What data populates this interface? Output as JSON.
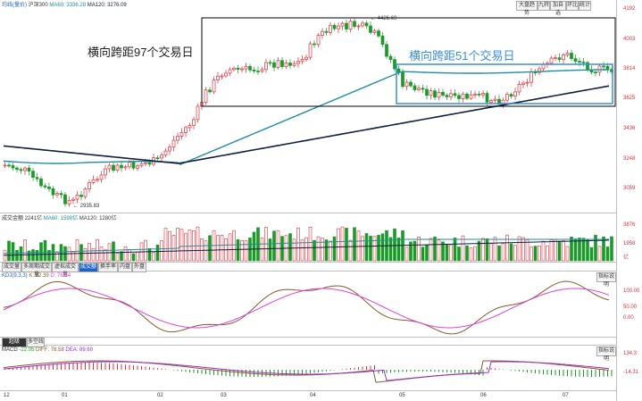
{
  "top_toolbar": {
    "buttons": [
      "大盘趋势",
      "九转",
      "加自选",
      "环比",
      "统计"
    ]
  },
  "main_chart": {
    "legend": {
      "indicator": "均线(量价)",
      "stock": "沪深300",
      "ma60": "MA60: 3336.28",
      "ma120": "MA120: 3276.09"
    },
    "axis": [
      "4192",
      "4003",
      "3814",
      "3625",
      "3436",
      "3248",
      "3059"
    ],
    "high_label": "4426.69",
    "low_label": "2935.83",
    "annotation_97": "横向跨距97个交易日",
    "annotation_51": "横向跨距51个交易日"
  },
  "volume_panel": {
    "legend": {
      "title": "成交金额",
      "v1": "2241亿",
      "v2": "MA60: 1598亿",
      "v3": "MA120: 1280亿"
    },
    "axis": [
      "3876",
      "1958",
      "亿"
    ],
    "tabs": [
      "成交量",
      "多周期成交量",
      "虚拟成交量",
      "成交额",
      "换手率",
      "内盘",
      "外盘"
    ],
    "active_tab": "成交额"
  },
  "kdj_panel": {
    "legend": {
      "title": "KDJ(9,3,3)",
      "k": "K: 82.39",
      "d": "D: 76.64"
    },
    "axis": [
      "100.00",
      "50.00",
      "0.00"
    ],
    "button": "指标说明",
    "tabs": [
      "超级MACD",
      "多空线"
    ]
  },
  "macd_panel": {
    "legend": {
      "title": "MACD",
      "v": "-22.05",
      "diff": "DIFF: 78.58",
      "dea": "DEA: 89.60"
    },
    "axis": [
      "134.3",
      "-14.31"
    ],
    "button": "指标说明"
  },
  "x_axis": [
    "12",
    "01",
    "02",
    "03",
    "04",
    "05",
    "06",
    "07"
  ],
  "colors": {
    "up": "#e0303a",
    "down": "#1a9a28",
    "ma60": "#1f8fa0",
    "ma120": "#102040",
    "annot": "#3a8fdc",
    "k": "#8b5a2b",
    "d": "#e040e0"
  }
}
